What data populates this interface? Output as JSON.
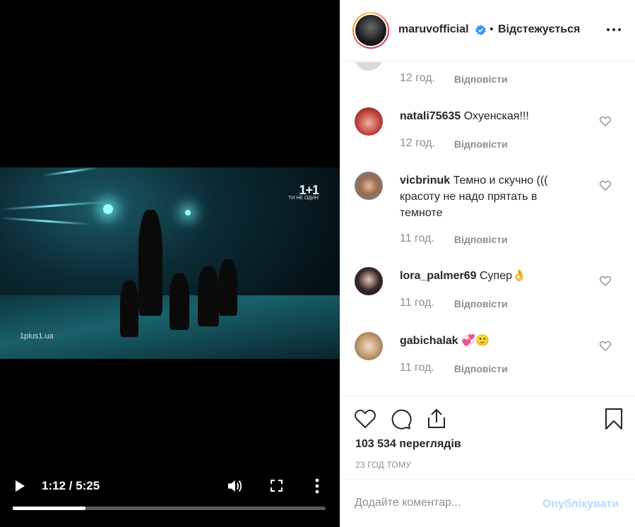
{
  "video": {
    "channel_logo": "1+1",
    "channel_slogan": "ТИ НЕ ОДИН",
    "watermark": "1plus1.ua",
    "time": "1:12 / 5:25",
    "progress_fraction": 0.232
  },
  "header": {
    "username": "maruvofficial",
    "separator": "•",
    "follow_status": "Відстежується"
  },
  "comments": [
    {
      "username": "",
      "text": "",
      "time": "12 год.",
      "reply": "Відповісти",
      "avatar_color": "#cfcfcf"
    },
    {
      "username": "natali75635",
      "text": "Охуенская!!!",
      "time": "12 год.",
      "reply": "Відповісти",
      "avatar_color": "#c0413b"
    },
    {
      "username": "vicbrinuk",
      "text": "Темно и скучно ((( красоту не надо прятать в темноте",
      "time": "11 год.",
      "reply": "Відповісти",
      "avatar_color": "#6b86a3"
    },
    {
      "username": "lora_palmer69",
      "text": "Супер👌",
      "time": "11 год.",
      "reply": "Відповісти",
      "avatar_color": "#2a2a2a"
    },
    {
      "username": "gabichalak",
      "text": "💞🙂",
      "time": "11 год.",
      "reply": "Відповісти",
      "avatar_color": "#c9a27a"
    }
  ],
  "actions": {
    "views": "103 534 переглядів",
    "ago": "23 ГОД ТОМУ"
  },
  "comment_bar": {
    "placeholder": "Додайте коментар...",
    "publish_label": "Опублікувати"
  },
  "colors": {
    "text": "#262626",
    "muted": "#8e8e8e",
    "verified": "#3897f0",
    "publish_disabled": "#b3dbff"
  }
}
